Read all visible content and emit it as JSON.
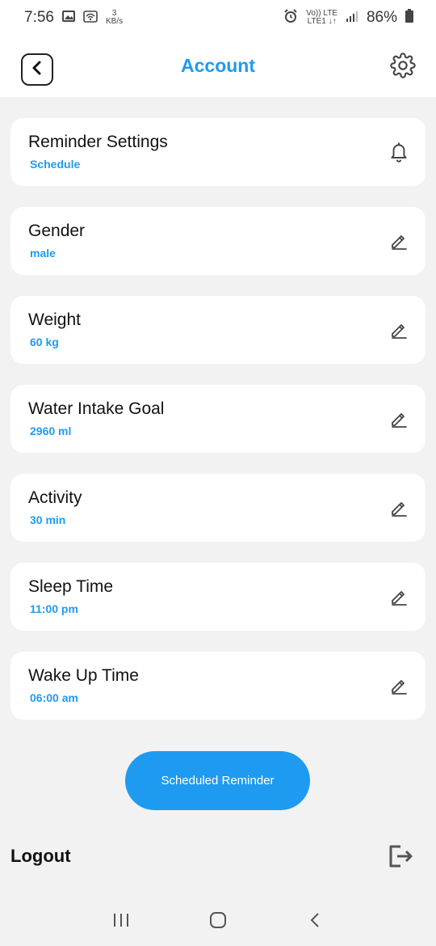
{
  "status_bar": {
    "time": "7:56",
    "speed_value": "3",
    "speed_unit": "KB/s",
    "network_label_top": "Vo)) LTE",
    "network_label_bottom": "LTE1 ↓↑",
    "battery": "86%"
  },
  "header": {
    "title": "Account",
    "back_icon": "chevron-left-icon",
    "settings_icon": "gear-icon"
  },
  "cards": [
    {
      "title": "Reminder Settings",
      "value": "Schedule",
      "icon": "bell-icon"
    },
    {
      "title": "Gender",
      "value": "male",
      "icon": "pencil-icon"
    },
    {
      "title": "Weight",
      "value": "60 kg",
      "icon": "pencil-icon"
    },
    {
      "title": "Water Intake Goal",
      "value": "2960 ml",
      "icon": "pencil-icon"
    },
    {
      "title": "Activity",
      "value": "30 min",
      "icon": "pencil-icon"
    },
    {
      "title": "Sleep Time",
      "value": "11:00 pm",
      "icon": "pencil-icon"
    },
    {
      "title": "Wake Up Time",
      "value": "06:00 am",
      "icon": "pencil-icon"
    }
  ],
  "scheduled_button": {
    "label": "Scheduled Reminder"
  },
  "logout": {
    "label": "Logout",
    "icon": "logout-icon"
  },
  "colors": {
    "accent": "#1e9bf0",
    "background": "#f2f2f2",
    "card": "#ffffff"
  }
}
